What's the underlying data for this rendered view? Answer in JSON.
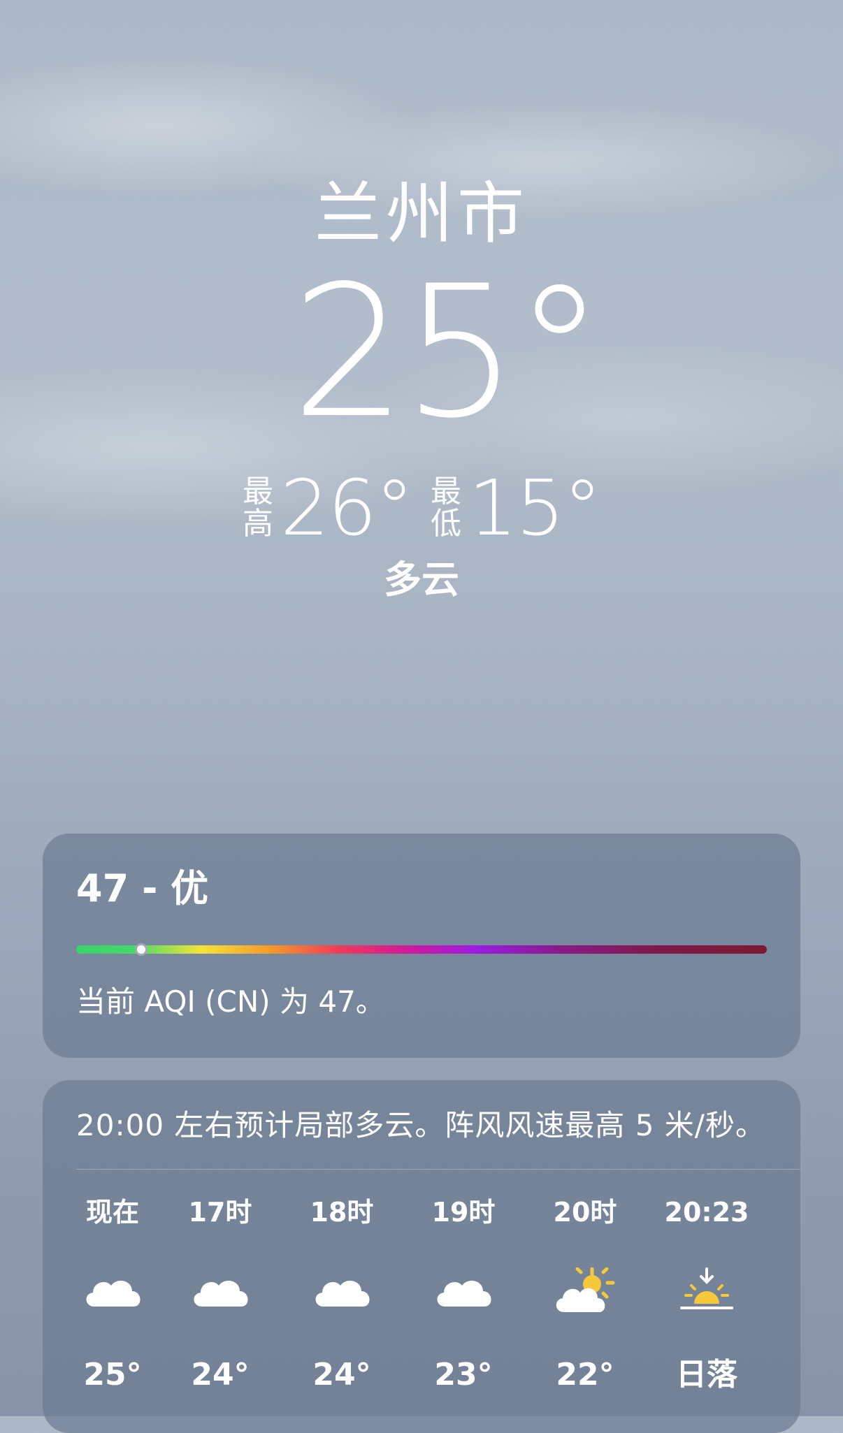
{
  "header": {
    "city": "兰州市",
    "temperature": "25°",
    "high_label_1": "最",
    "high_label_2": "高",
    "high_value": "26°",
    "low_label_1": "最",
    "low_label_2": "低",
    "low_value": "15°",
    "condition": "多云"
  },
  "aqi": {
    "title": "47 - 优",
    "value": 47,
    "scale_max": 500,
    "description": "当前 AQI (CN) 为 47。"
  },
  "forecast": {
    "summary": "20:00 左右预计局部多云。阵风风速最高 5 米/秒。",
    "hours": [
      {
        "label": "现在",
        "icon": "cloud-icon",
        "temp": "25°"
      },
      {
        "label": "17时",
        "icon": "cloud-icon",
        "temp": "24°"
      },
      {
        "label": "18时",
        "icon": "cloud-icon",
        "temp": "24°"
      },
      {
        "label": "19时",
        "icon": "cloud-icon",
        "temp": "23°"
      },
      {
        "label": "20时",
        "icon": "partly-sunny-icon",
        "temp": "22°"
      },
      {
        "label": "20:23",
        "icon": "sunset-icon",
        "temp": "日落"
      }
    ]
  },
  "colors": {
    "card": "#6c7c92",
    "sun": "#f6c93b",
    "text": "#ffffff"
  }
}
